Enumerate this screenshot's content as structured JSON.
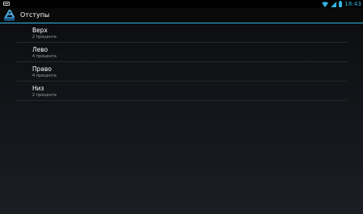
{
  "status_bar": {
    "time": "18:43",
    "left_icon": "screenshot-icon",
    "icons": [
      "wifi-icon",
      "signal-icon",
      "battery-icon"
    ],
    "accent_color": "#33b5e5"
  },
  "action_bar": {
    "title": "Отступы",
    "app_icon": "app-icon",
    "accent_color": "#33b5e5"
  },
  "preferences": [
    {
      "title": "Верх",
      "summary": "2 процента"
    },
    {
      "title": "Лево",
      "summary": "4 процента"
    },
    {
      "title": "Право",
      "summary": "4 процента"
    },
    {
      "title": "Низ",
      "summary": "2 процента"
    }
  ]
}
